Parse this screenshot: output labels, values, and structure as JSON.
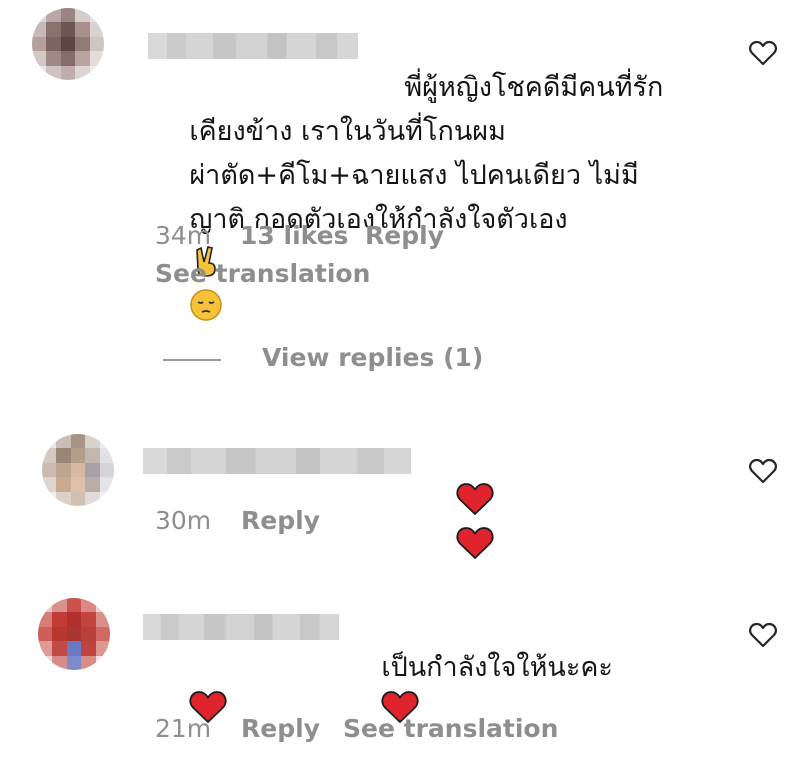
{
  "comments": [
    {
      "text_lines": [
        "พี่ผู้หญิงโชคดีมีคนที่รัก",
        "เคียงข้าง เราในวันที่โกนผม",
        "ผ่าตัด+คีโม+ฉายแสง ไปคนเดียว ไม่มี",
        "ญาติ กอดตัวเองให้กำลังใจตัวเอง"
      ],
      "emojis": [
        "victory-hand",
        "pensive-face"
      ],
      "time": "34m",
      "likes": "13 likes",
      "reply": "Reply",
      "translation": "See translation",
      "view_replies": "View replies (1)"
    },
    {
      "text": "",
      "emojis": [
        "red-heart",
        "red-heart"
      ],
      "time": "30m",
      "reply": "Reply"
    },
    {
      "text_line1": "เป็นกำลังใจให้นะคะ",
      "emojis": [
        "red-heart",
        "red-heart"
      ],
      "time": "21m",
      "reply": "Reply",
      "translation": "See translation"
    }
  ],
  "colors": {
    "text": "#151515",
    "meta": "#8e8e8e",
    "heart_emoji": "#e0242d",
    "background": "#ffffff"
  }
}
